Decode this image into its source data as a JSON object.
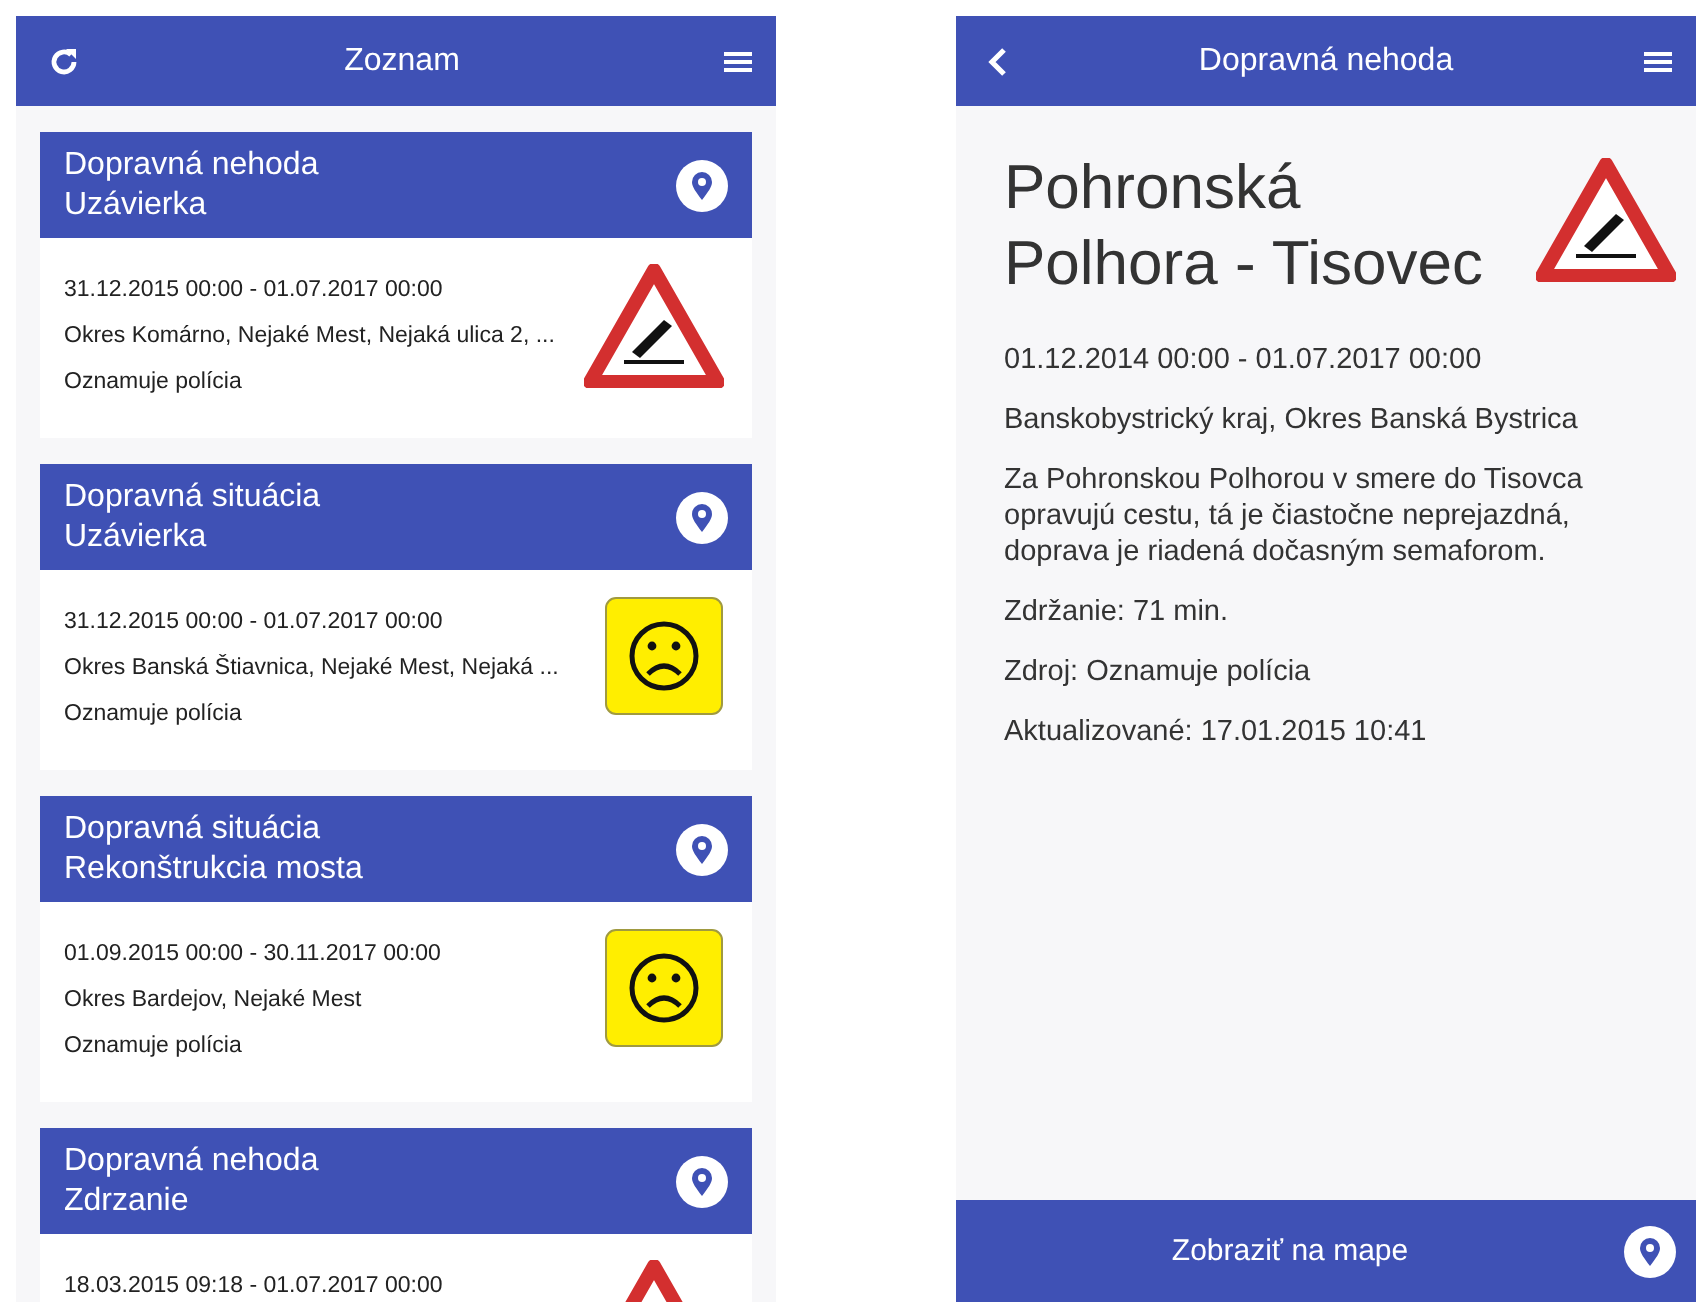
{
  "list_screen": {
    "title": "Zoznam",
    "items": [
      {
        "kind": "accident",
        "category": "Dopravná nehoda",
        "type": "Uzávierka",
        "lines": [
          "31.12.2015 00:00 - 01.07.2017 00:00",
          "Okres Komárno, Nejaké Mest, Nejaká ulica 2, ...",
          "Oznamuje polícia"
        ]
      },
      {
        "kind": "situation",
        "category": "Dopravná situácia",
        "type": "Uzávierka",
        "lines": [
          "31.12.2015 00:00 - 01.07.2017 00:00",
          "Okres Banská Štiavnica, Nejaké Mest, Nejaká ...",
          "Oznamuje polícia"
        ]
      },
      {
        "kind": "situation",
        "category": "Dopravná situácia",
        "type": "Rekonštrukcia mosta",
        "lines": [
          "01.09.2015 00:00 - 30.11.2017 00:00",
          "Okres Bardejov, Nejaké Mest",
          "Oznamuje polícia"
        ]
      },
      {
        "kind": "accident",
        "category": "Dopravná nehoda",
        "type": "Zdrzanie",
        "lines": [
          "18.03.2015 09:18 - 01.07.2017 00:00"
        ]
      }
    ]
  },
  "detail_screen": {
    "title": "Dopravná nehoda",
    "kind": "accident",
    "heading": "Pohronská Polhora - Tisovec",
    "paragraphs": [
      "01.12.2014 00:00 - 01.07.2017 00:00",
      "Banskobystrický kraj, Okres Banská Bystrica",
      "Za Pohronskou Polhorou v smere do Tisovca opravujú cestu, tá je čiastočne neprejazdná, doprava je riadená dočasným semaforom.",
      "Zdržanie: 71 min.",
      "Zdroj: Oznamuje polícia",
      "Aktualizované: 17.01.2015 10:41"
    ],
    "map_button": "Zobraziť na mape"
  }
}
